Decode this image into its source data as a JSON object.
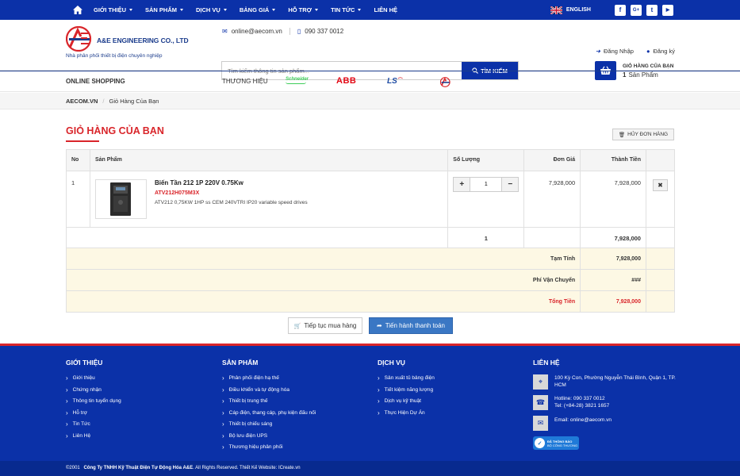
{
  "colors": {
    "primary": "#0b31a8",
    "accent": "#d9252a",
    "button": "#3a77c4",
    "cream": "#fdf8e4"
  },
  "topnav": {
    "items": [
      "GIỚI THIỆU",
      "SẢN PHẨM",
      "DỊCH VỤ",
      "BẢNG GIÁ",
      "HỖ TRỢ",
      "TIN TỨC",
      "LIÊN HỆ"
    ],
    "language": "ENGLISH",
    "social": [
      "f",
      "G+",
      "t",
      "▶"
    ]
  },
  "header": {
    "logo_name": "A&E ENGINEERING CO., LTD",
    "tagline": "Nhà phân phối thiết bị điện chuyên nghiệp",
    "email": "online@aecom.vn",
    "phone": "090 337 0012",
    "search_placeholder": "Tìm kiếm thông tin sản phẩm...",
    "search_button": "TÌM KIẾM",
    "login": "Đăng Nhập",
    "register": "Đăng ký",
    "cart_title": "GIỎ HÀNG CỦA BẠN",
    "cart_count": "1",
    "cart_unit": "Sản Phẩm"
  },
  "brandbar": {
    "online_shopping": "ONLINE SHOPPING",
    "brands_label": "THƯƠNG HIỆU",
    "brands": [
      "Schneider",
      "ABB",
      "LS",
      "A&E"
    ]
  },
  "breadcrumb": {
    "home": "AECOM.VN",
    "current": "Giỏ Hàng Của Bạn"
  },
  "cart": {
    "title": "GIỎ HÀNG CỦA BẠN",
    "cancel_button": "HỦY ĐƠN HÀNG",
    "columns": [
      "No",
      "Sản Phẩm",
      "Số Lượng",
      "Đơn Giá",
      "Thành Tiền"
    ],
    "items": [
      {
        "no": "1",
        "name": "Biến Tần 212 1P 220V 0.75Kw",
        "sku": "ATV212H075M3X",
        "description": "ATV212 0,75KW 1HP ss CEM 240VTRI IP20 variable speed drives",
        "quantity": "1",
        "unit_price": "7,928,000",
        "total": "7,928,000"
      }
    ],
    "sum_quantity": "1",
    "sum_total": "7,928,000",
    "subtotal_label": "Tạm Tính",
    "subtotal": "7,928,000",
    "shipping_label": "Phí Vận Chuyển",
    "shipping": "###",
    "grand_total_label": "Tổng Tiền",
    "grand_total": "7,928,000",
    "continue_button": "Tiếp tục mua hàng",
    "checkout_button": "Tiến hành thanh toán"
  },
  "footer": {
    "about": {
      "title": "GIỚI THIỆU",
      "items": [
        "Giới thiệu",
        "Chứng nhận",
        "Thông tin tuyển dụng",
        "Hỗ trợ",
        "Tin Tức",
        "Liên Hệ"
      ]
    },
    "products": {
      "title": "SẢN PHẨM",
      "items": [
        "Phân phối điện hạ thế",
        "Điều khiển và tự động hóa",
        "Thiết bị trung thế",
        "Cáp điện, thang cáp, phụ kiện đấu nối",
        "Thiết bị chiếu sáng",
        "Bộ lưu điện UPS",
        "Thương hiệu phân phối"
      ]
    },
    "services": {
      "title": "DỊCH VỤ",
      "items": [
        "Sản xuất tủ bảng điện",
        "Tiết kiệm năng lượng",
        "Dịch vụ kỹ thuật",
        "Thực Hiện Dự Án"
      ]
    },
    "contact": {
      "title": "LIÊN HỆ",
      "address": "100 Kỳ Con, Phường Nguyễn Thái Bình, Quận 1, TP. HCM",
      "hotline": "Hotline: 090 337 0012",
      "tel": "Tel: (+84-28) 3821 1657",
      "email": "Email: online@aecom.vn",
      "badge_line1": "ĐÃ THÔNG BÁO",
      "badge_line2": "BỘ CÔNG THƯƠNG"
    },
    "copyright_prefix": "©2001",
    "copyright_company": "Công Ty TNHH Kỹ Thuật Điện Tự Động Hóa A&E",
    "copyright_suffix": ". All Rights Reserved. Thiết Kế Website: ICreate.vn"
  }
}
